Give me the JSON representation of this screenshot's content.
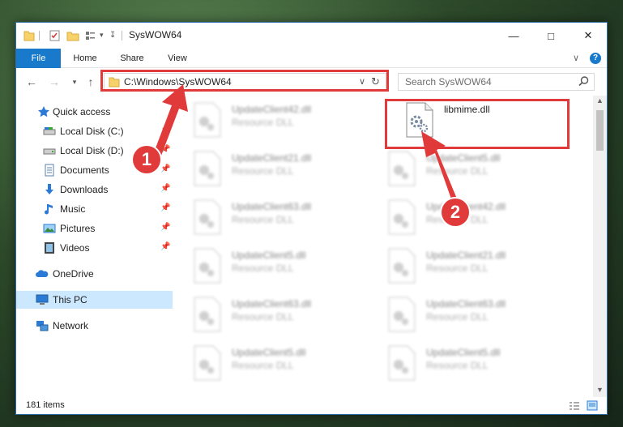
{
  "window": {
    "title": "SysWOW64",
    "controls": {
      "minimize": "—",
      "maximize": "□",
      "close": "✕"
    }
  },
  "ribbon": {
    "tabs": [
      "File",
      "Home",
      "Share",
      "View"
    ],
    "expand": "∨",
    "help": "?"
  },
  "address_bar": {
    "path": "C:\\Windows\\SysWOW64",
    "dropdown": "∨",
    "refresh": "↻"
  },
  "search": {
    "placeholder": "Search SysWOW64"
  },
  "sidebar": {
    "items": [
      {
        "label": "Quick access",
        "icon": "star-icon",
        "pinned": false
      },
      {
        "label": "Local Disk (C:)",
        "icon": "drive-icon",
        "pinned": true
      },
      {
        "label": "Local Disk (D:)",
        "icon": "drive-icon",
        "pinned": true
      },
      {
        "label": "Documents",
        "icon": "documents-icon",
        "pinned": true
      },
      {
        "label": "Downloads",
        "icon": "download-icon",
        "pinned": true
      },
      {
        "label": "Music",
        "icon": "music-icon",
        "pinned": true
      },
      {
        "label": "Pictures",
        "icon": "pictures-icon",
        "pinned": true
      },
      {
        "label": "Videos",
        "icon": "videos-icon",
        "pinned": true
      },
      {
        "label": "OneDrive",
        "icon": "cloud-icon",
        "pinned": false
      },
      {
        "label": "This PC",
        "icon": "computer-icon",
        "pinned": false,
        "selected": true
      },
      {
        "label": "Network",
        "icon": "network-icon",
        "pinned": false
      }
    ]
  },
  "files": [
    {
      "name": "UpdateClient42.dll",
      "type": "Resource DLL",
      "blurred": true
    },
    {
      "name": "libmime.dll",
      "type": "",
      "blurred": false,
      "highlighted": true
    },
    {
      "name": "UpdateClient21.dll",
      "type": "Resource DLL",
      "blurred": true
    },
    {
      "name": "UpdateClient5.dll",
      "type": "Resource DLL",
      "blurred": true
    },
    {
      "name": "UpdateClient63.dll",
      "type": "Resource DLL",
      "blurred": true
    },
    {
      "name": "UpdateClient42.dll",
      "type": "Resource DLL",
      "blurred": true
    },
    {
      "name": "UpdateClient5.dll",
      "type": "Resource DLL",
      "blurred": true
    },
    {
      "name": "UpdateClient21.dll",
      "type": "Resource DLL",
      "blurred": true
    },
    {
      "name": "UpdateClient63.dll",
      "type": "Resource DLL",
      "blurred": true
    },
    {
      "name": "UpdateClient63.dll",
      "type": "Resource DLL",
      "blurred": true
    },
    {
      "name": "UpdateClient5.dll",
      "type": "Resource DLL",
      "blurred": true
    },
    {
      "name": "UpdateClient5.dll",
      "type": "Resource DLL",
      "blurred": true
    }
  ],
  "status": {
    "item_count": "181 items"
  },
  "annotations": {
    "step1": "1",
    "step2": "2",
    "color": "#e03a3a"
  }
}
